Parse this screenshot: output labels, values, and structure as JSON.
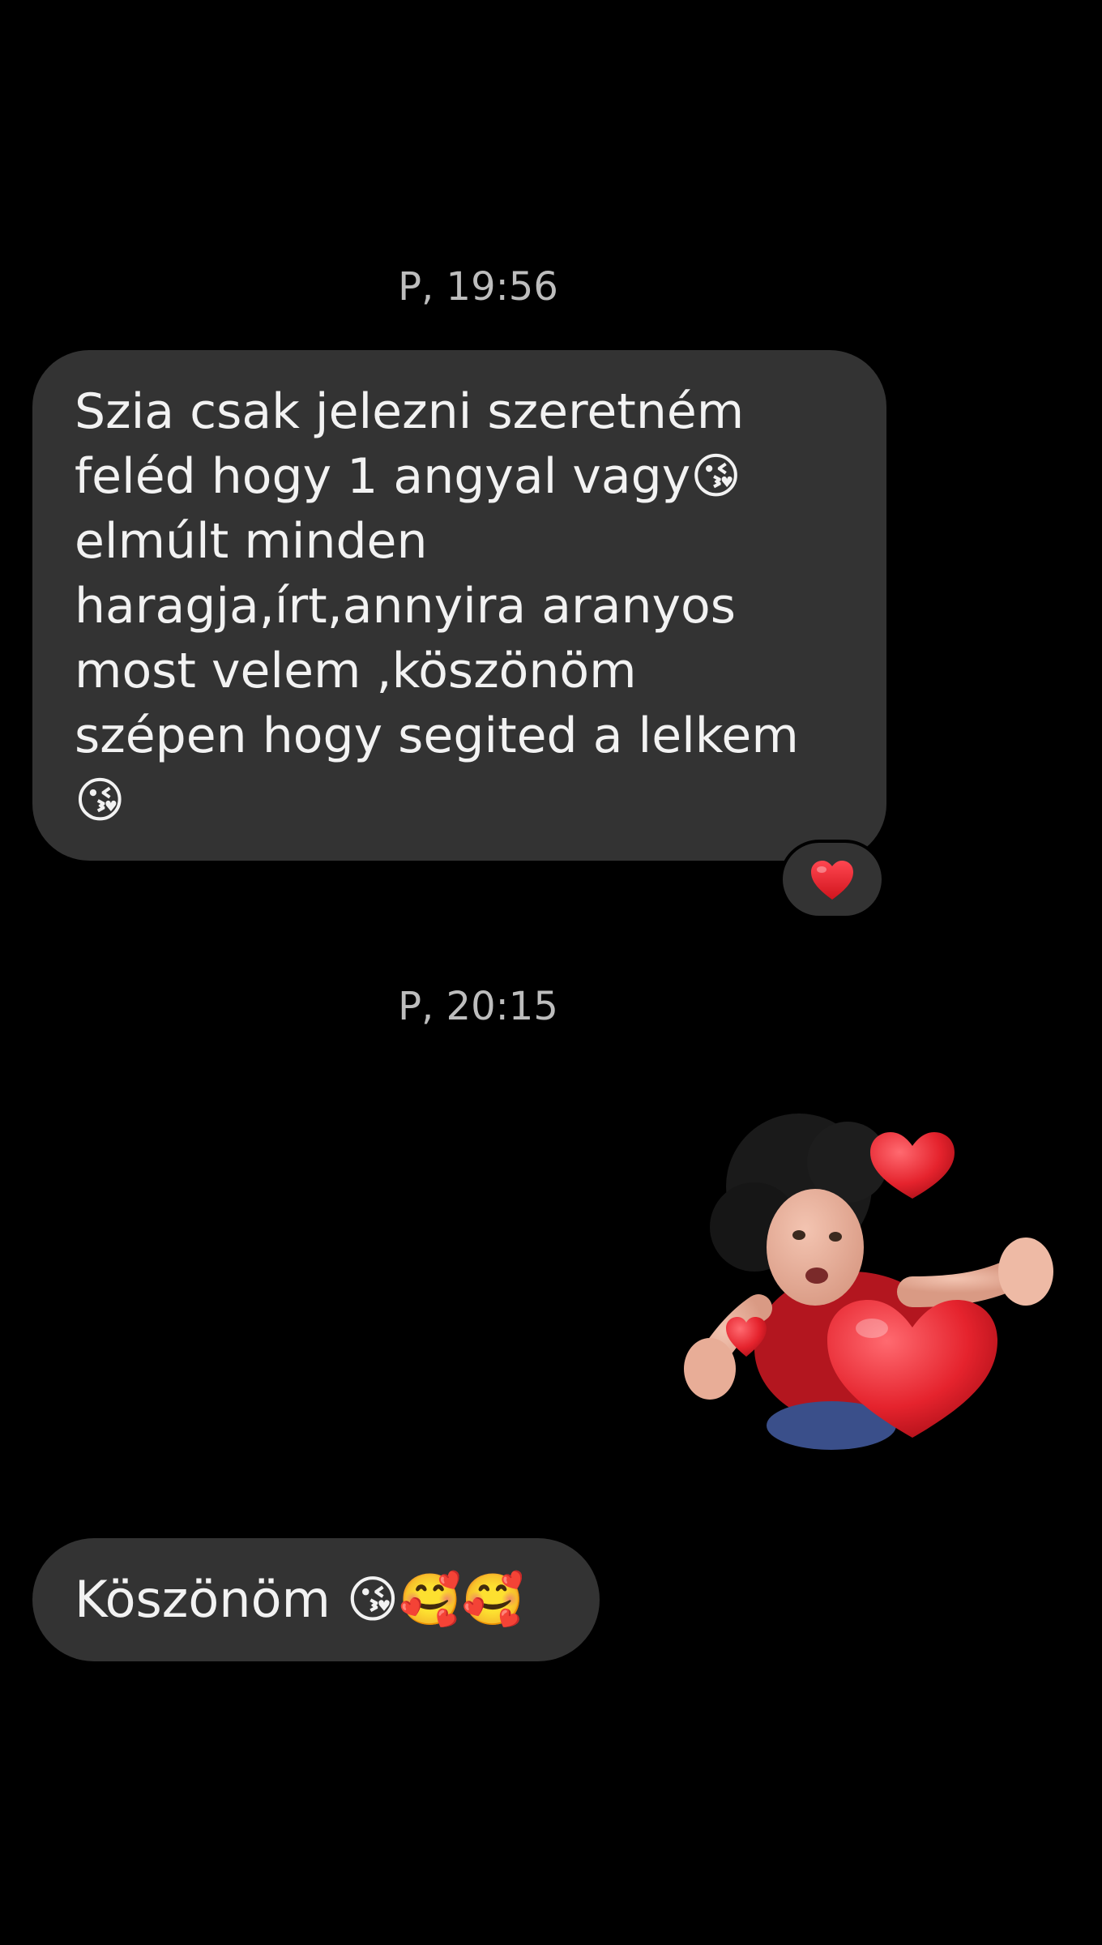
{
  "conversation": {
    "messages": [
      {
        "timestamp": "P, 19:56",
        "text": "Szia csak jelezni szeretném\nfeléd hogy 1 angyal vagy😘\nelmúlt minden\nharagja,írt,annyira aranyos\nmost velem ,köszönöm\nszépen hogy segited a lelkem\n😘",
        "reaction": "❤️"
      },
      {
        "timestamp": "P, 20:15",
        "sticker": "woman-with-hearts-sticker"
      },
      {
        "text": "Köszönöm 😘🥰🥰"
      }
    ]
  },
  "icons": {
    "reaction_icon": "red-heart-icon",
    "sticker_icon": "woman-with-hearts-sticker"
  },
  "colors": {
    "background": "#000000",
    "bubble": "#333333",
    "text": "#f2f2f2",
    "timestamp": "#bdbdbd",
    "heart": "#e4262f"
  }
}
